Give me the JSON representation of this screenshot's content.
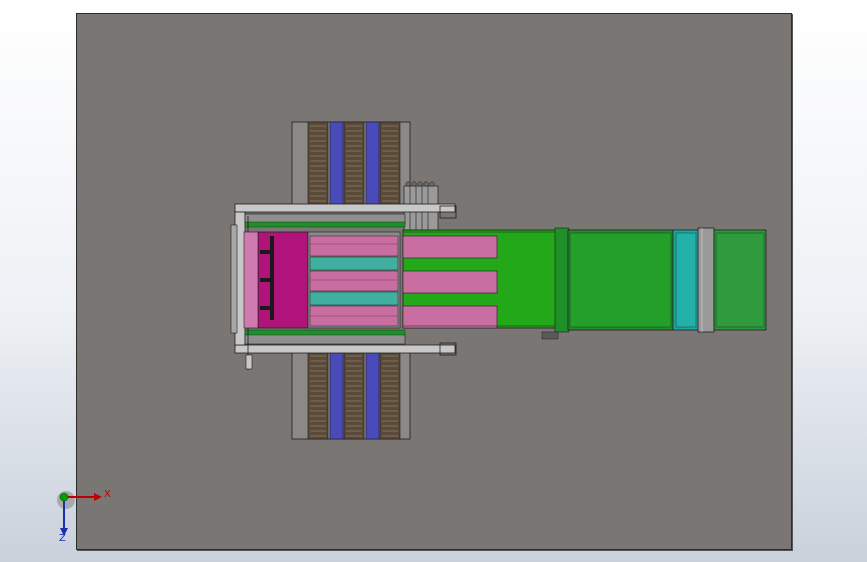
{
  "viewport": {
    "background_top": "#ffffff",
    "background_bottom": "#c9d1db"
  },
  "sheet": {
    "color": "#7a7673"
  },
  "triad": {
    "x_label": "X",
    "z_label": "Z",
    "x_color": "#c00000",
    "y_color": "#00a000",
    "z_color": "#1a2fb0"
  },
  "colors": {
    "magenta": "#b0147a",
    "pink": "#c86ea0",
    "teal": "#3fb0a0",
    "green_bright": "#22a818",
    "green_dark": "#1f8f2a",
    "cyan": "#1aa8a0",
    "blue": "#4a4ab8",
    "brown": "#5a4a3a",
    "frame": "#c8c8c8",
    "outline": "#1e1e1e"
  }
}
